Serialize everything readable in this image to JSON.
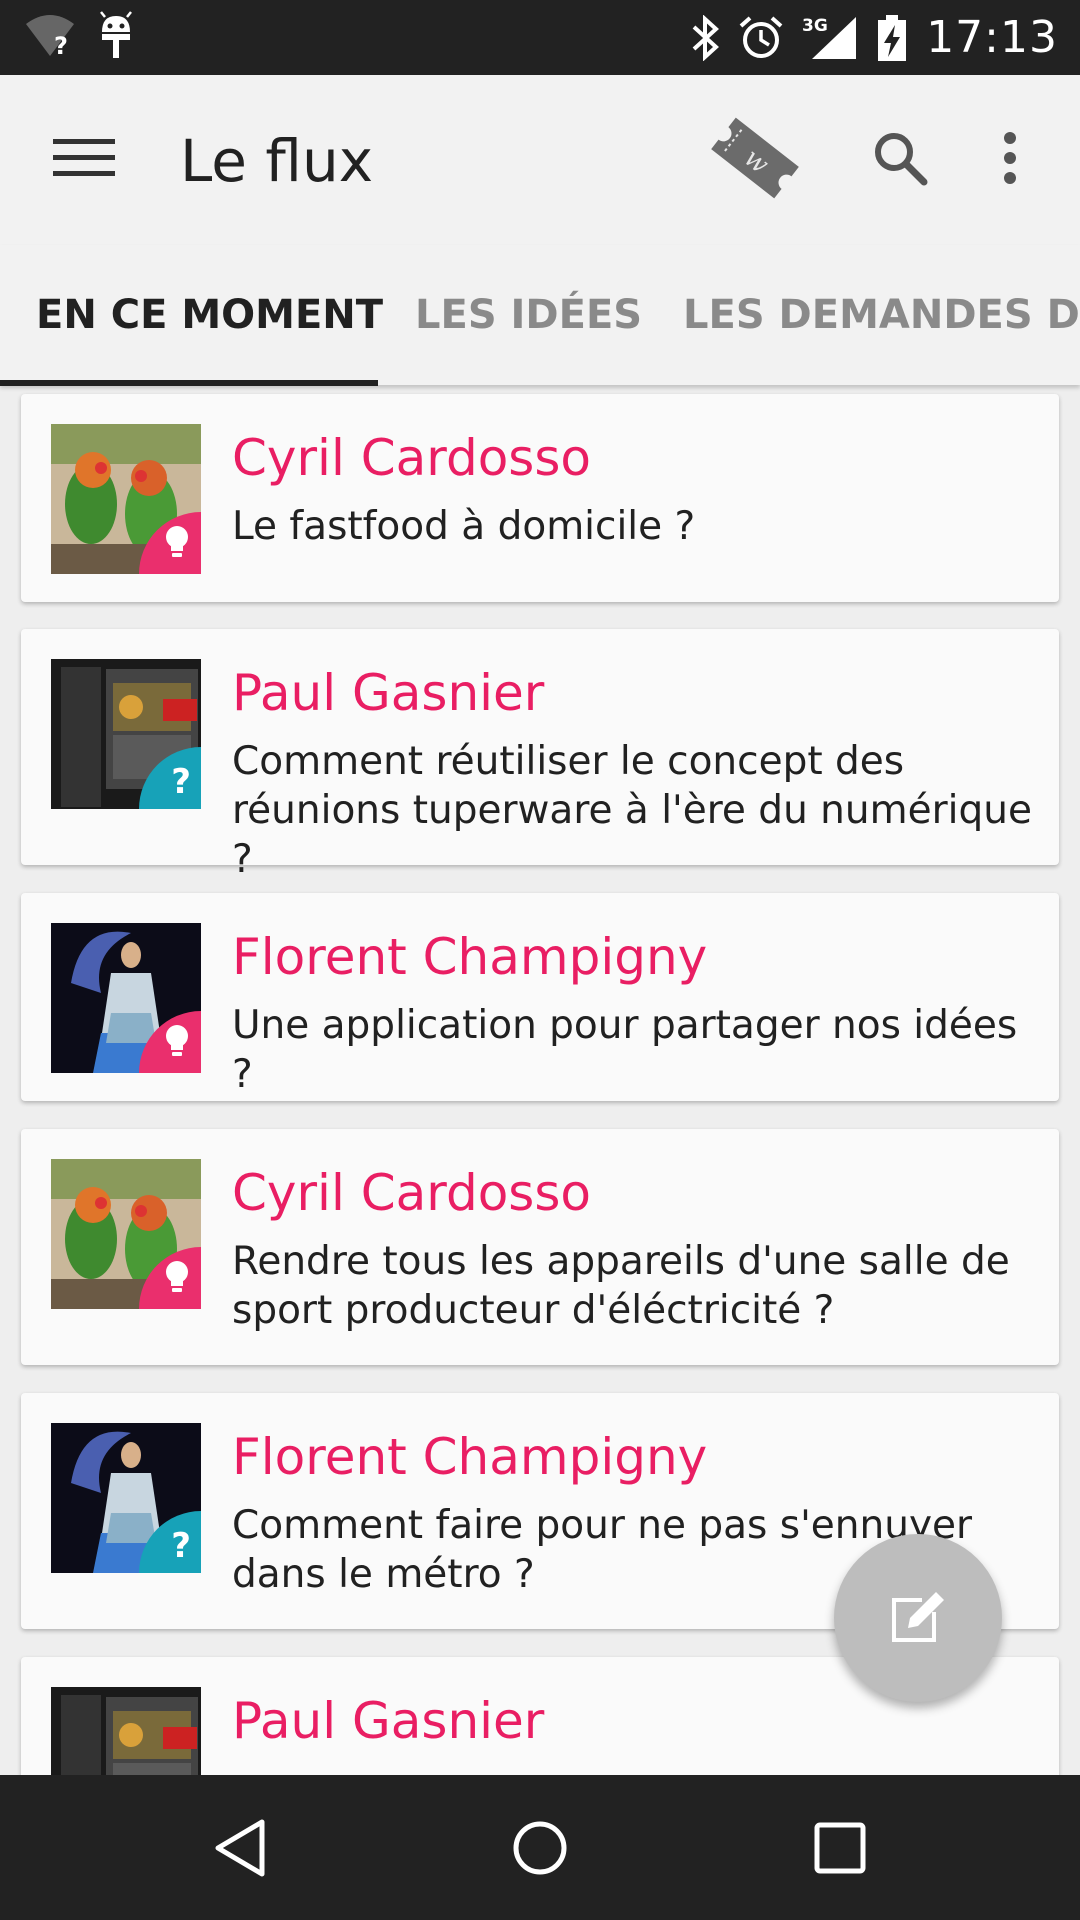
{
  "status_bar": {
    "time": "17:13",
    "network": "3G",
    "icons": [
      "wifi-unknown-icon",
      "android-debug-icon",
      "bluetooth-icon",
      "alarm-icon",
      "signal-icon",
      "battery-charging-icon"
    ]
  },
  "app_bar": {
    "title": "Le flux",
    "icons": [
      "menu-icon",
      "ticket-icon",
      "search-icon",
      "more-vert-icon"
    ]
  },
  "tabs": [
    {
      "label": "EN CE MOMENT",
      "active": true
    },
    {
      "label": "LES IDÉES",
      "active": false
    },
    {
      "label": "LES DEMANDES D'IDÉES",
      "active": false
    }
  ],
  "feed": [
    {
      "author": "Cyril Cardosso",
      "text": "Le fastfood à domicile ?",
      "type": "idea",
      "badge": ""
    },
    {
      "author": "Paul Gasnier",
      "text": "Comment réutiliser le concept des réunions tuperware à l'ère du numérique ?",
      "type": "question",
      "badge": "?"
    },
    {
      "author": "Florent Champigny",
      "text": "Une application pour partager nos idées ?",
      "type": "idea",
      "badge": ""
    },
    {
      "author": "Cyril Cardosso",
      "text": "Rendre tous les appareils d'une salle de sport producteur d'éléctricité ?",
      "type": "idea",
      "badge": ""
    },
    {
      "author": "Florent Champigny",
      "text": "Comment faire pour ne pas s'ennuyer dans le métro ?",
      "type": "question",
      "badge": "?"
    },
    {
      "author": "Paul Gasnier",
      "text": "",
      "type": "idea",
      "badge": ""
    }
  ],
  "fab": {
    "icon": "edit-icon"
  },
  "nav_bar": {
    "icons": [
      "back-icon",
      "home-icon",
      "recents-icon"
    ]
  },
  "colors": {
    "accent": "#e91e63",
    "idea_badge": "#ea2f6d",
    "question_badge": "#17a2b8",
    "fab": "#bdbdbd"
  }
}
